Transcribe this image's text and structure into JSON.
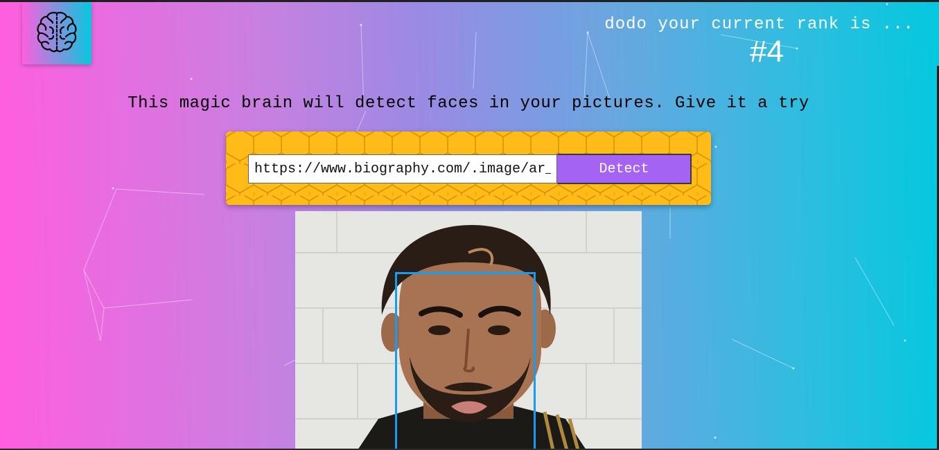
{
  "header": {
    "logo_icon": "brain-icon",
    "rank_label": "dodo your current rank is ...",
    "rank_value": "#4"
  },
  "main": {
    "tagline": "This magic brain will detect faces in your pictures. Give it a try",
    "form": {
      "image_url_value": "https://www.biography.com/.image/ar_",
      "detect_label": "Detect"
    },
    "result": {
      "image_alt": "photo of a bearded man with short hair",
      "face_box_icon": "face-bounding-box"
    }
  },
  "colors": {
    "gradient_start": "#ff5edf",
    "gradient_end": "#04c8de",
    "form_background": "#ffbb17",
    "button": "#a463f2",
    "face_box": "#149df2"
  }
}
